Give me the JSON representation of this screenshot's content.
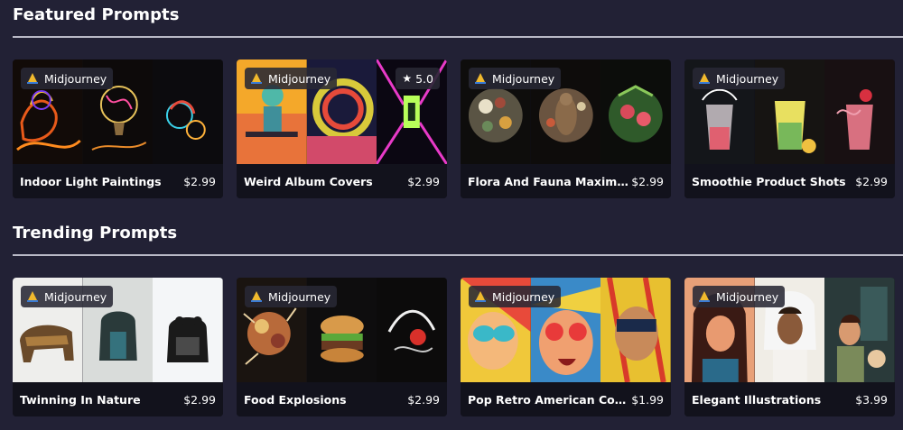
{
  "featured": {
    "title": "Featured Prompts",
    "cards": [
      {
        "model": "Midjourney",
        "name": "Indoor Light Paintings",
        "price": "$2.99",
        "rating": null
      },
      {
        "model": "Midjourney",
        "name": "Weird Album Covers",
        "price": "$2.99",
        "rating": "5.0"
      },
      {
        "model": "Midjourney",
        "name": "Flora And Fauna Maximalist I...",
        "price": "$2.99",
        "rating": null
      },
      {
        "model": "Midjourney",
        "name": "Smoothie Product Shots",
        "price": "$2.99",
        "rating": null
      }
    ]
  },
  "trending": {
    "title": "Trending Prompts",
    "cards": [
      {
        "model": "Midjourney",
        "name": "Twinning In Nature",
        "price": "$2.99",
        "rating": null
      },
      {
        "model": "Midjourney",
        "name": "Food Explosions",
        "price": "$2.99",
        "rating": null
      },
      {
        "model": "Midjourney",
        "name": "Pop Retro American Comic St...",
        "price": "$1.99",
        "rating": null
      },
      {
        "model": "Midjourney",
        "name": "Elegant Illustrations",
        "price": "$3.99",
        "rating": null
      }
    ]
  },
  "icons": {
    "model_logo": "midjourney-logo-icon",
    "rating": "star-icon"
  },
  "colors": {
    "background": "#222135",
    "divider": "#b9b9c6",
    "card_footer": "#12121c"
  }
}
